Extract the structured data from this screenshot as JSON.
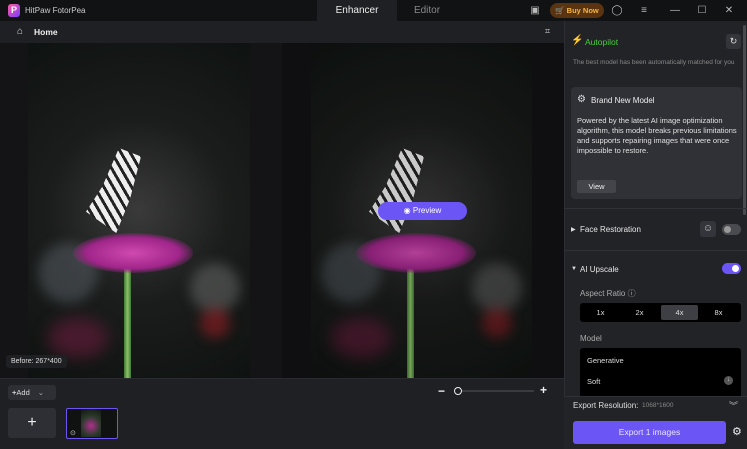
{
  "app": {
    "title": "HitPaw FotorPea",
    "tabs": [
      "Enhancer",
      "Editor"
    ],
    "buy_now": "Buy Now"
  },
  "nav": {
    "home": "Home"
  },
  "canvas": {
    "preview_label": "Preview",
    "before_label": "Before: 267*400"
  },
  "bottom": {
    "add_label": "Add"
  },
  "side": {
    "autopilot": "Autopilot",
    "autopilot_desc": "The best model has been automatically matched for you",
    "card_title": "Brand New Model",
    "card_body": "Powered by the latest AI image optimization algorithm, this model breaks previous limitations and supports repairing images that were once impossible to restore.",
    "card_view": "View",
    "face_restoration": "Face Restoration",
    "face_restoration_on": false,
    "ai_upscale": "AI Upscale",
    "ai_upscale_on": true,
    "aspect_ratio": "Aspect Ratio",
    "ratios": [
      "1x",
      "2x",
      "4x",
      "8x"
    ],
    "selected_ratio": "4x",
    "model_label": "Model",
    "models": [
      "Generative",
      "Soft"
    ],
    "export_resolution_label": "Export Resolution:",
    "export_resolution": "1068*1600",
    "export_button": "Export 1 images"
  }
}
